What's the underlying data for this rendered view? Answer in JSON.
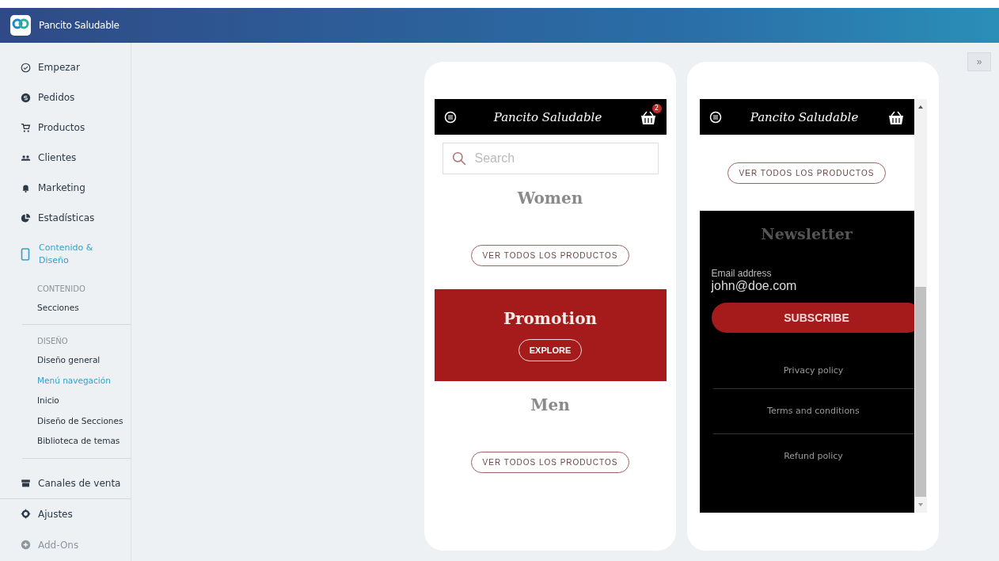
{
  "app": {
    "title": "Pancito Saludable",
    "collapse": "»"
  },
  "sidebar": {
    "items": [
      {
        "label": "Empezar",
        "selected": false
      },
      {
        "label": "Pedidos",
        "selected": false
      },
      {
        "label": "Productos",
        "selected": false
      },
      {
        "label": "Clientes",
        "selected": false
      },
      {
        "label": "Marketing",
        "selected": false
      },
      {
        "label": "Estadísticas",
        "selected": false
      },
      {
        "label": "Contenido & Diseño",
        "selected": true
      }
    ],
    "groups": [
      {
        "heading": "CONTENIDO",
        "items": [
          {
            "label": "Secciones",
            "selected": false
          }
        ]
      },
      {
        "heading": "DISEÑO",
        "items": [
          {
            "label": "Diseño general",
            "selected": false
          },
          {
            "label": "Menú navegación",
            "selected": true
          },
          {
            "label": "Inicio",
            "selected": false
          },
          {
            "label": "Diseño de Secciones",
            "selected": false
          },
          {
            "label": "Biblioteca de temas",
            "selected": false
          }
        ]
      }
    ],
    "bottom_items": [
      {
        "label": "Canales de venta",
        "selected": false
      },
      {
        "label": "Ajustes",
        "selected": false
      },
      {
        "label": "Add-Ons",
        "selected": false
      }
    ]
  },
  "previews": [
    {
      "logo": "Pancito Saludable",
      "cart_badge": "2",
      "blocks": [
        {
          "kind": "search",
          "placeholder": "Search"
        },
        {
          "kind": "heading",
          "text": "Women"
        },
        {
          "kind": "button",
          "label": "VER TODOS LOS PRODUCTOS"
        },
        {
          "kind": "promo",
          "title": "Promotion",
          "button": "EXPLORE"
        },
        {
          "kind": "heading",
          "text": "Men"
        },
        {
          "kind": "button",
          "label": "VER TODOS LOS PRODUCTOS"
        }
      ]
    },
    {
      "logo": "Pancito Saludable",
      "blocks": [
        {
          "kind": "button",
          "label": "VER TODOS LOS PRODUCTOS"
        },
        {
          "kind": "newsletter",
          "title": "Newsletter",
          "email_label": "Email address",
          "email_value": "john@doe.com",
          "button": "SUBSCRIBE"
        },
        {
          "kind": "links",
          "items": [
            "Privacy policy",
            "Terms and conditions",
            "Refund policy"
          ]
        }
      ]
    }
  ]
}
